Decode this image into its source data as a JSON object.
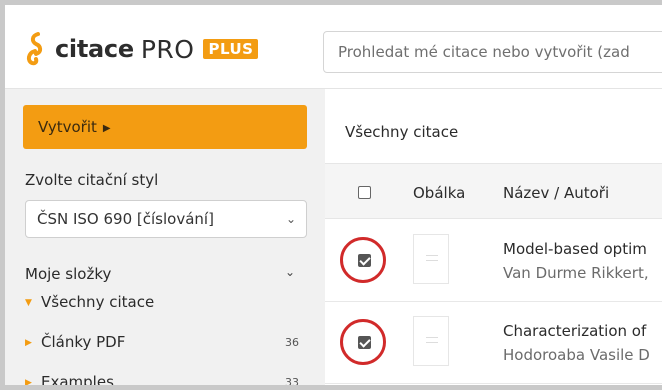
{
  "brand": {
    "word": "citace",
    "pro": "PRO",
    "plus": "PLUS",
    "accent_color": "#f39c12",
    "icon": "quote-s-logo-icon"
  },
  "search": {
    "placeholder": "Prohledat mé citace nebo vytvořit (zad"
  },
  "sidebar": {
    "create_label": "Vytvořit",
    "style_label": "Zvolte citační styl",
    "style_value": "ČSN ISO 690 [číslování]",
    "folders_title": "Moje složky",
    "folders": [
      {
        "label": "Všechny citace",
        "count": ""
      },
      {
        "label": "Články PDF",
        "count": "36"
      },
      {
        "label": "Examples",
        "count": "33"
      }
    ]
  },
  "main": {
    "title": "Všechny citace",
    "columns": {
      "cover": "Obálka",
      "name": "Název / Autoři"
    },
    "rows": [
      {
        "title": "Model-based optim",
        "authors": "Van Durme Rikkert,",
        "checked": true
      },
      {
        "title": "Characterization of",
        "authors": "Hodoroaba Vasile D",
        "checked": true
      }
    ],
    "highlight_color": "#d12a2a"
  }
}
